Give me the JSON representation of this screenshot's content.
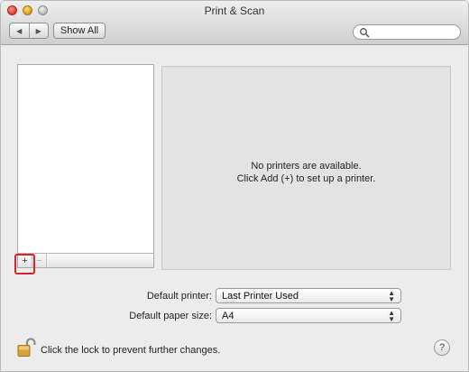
{
  "window": {
    "title": "Print & Scan"
  },
  "toolbar": {
    "back_icon": "left-arrow-icon",
    "forward_icon": "right-arrow-icon",
    "show_all_label": "Show All",
    "search_value": "",
    "search_icon": "magnifier-icon"
  },
  "printer_list": {
    "items": [],
    "add_label": "+",
    "remove_label": "−"
  },
  "detail": {
    "line1": "No printers are available.",
    "line2": "Click Add (+) to set up a printer."
  },
  "settings": {
    "default_printer_label": "Default printer:",
    "default_printer_value": "Last Printer Used",
    "default_paper_label": "Default paper size:",
    "default_paper_value": "A4"
  },
  "footer": {
    "lock_text": "Click the lock to prevent further changes.",
    "help_label": "?"
  },
  "colors": {
    "highlight": "#d8232a",
    "close": "#d2382e",
    "minimize": "#d99a1f"
  }
}
